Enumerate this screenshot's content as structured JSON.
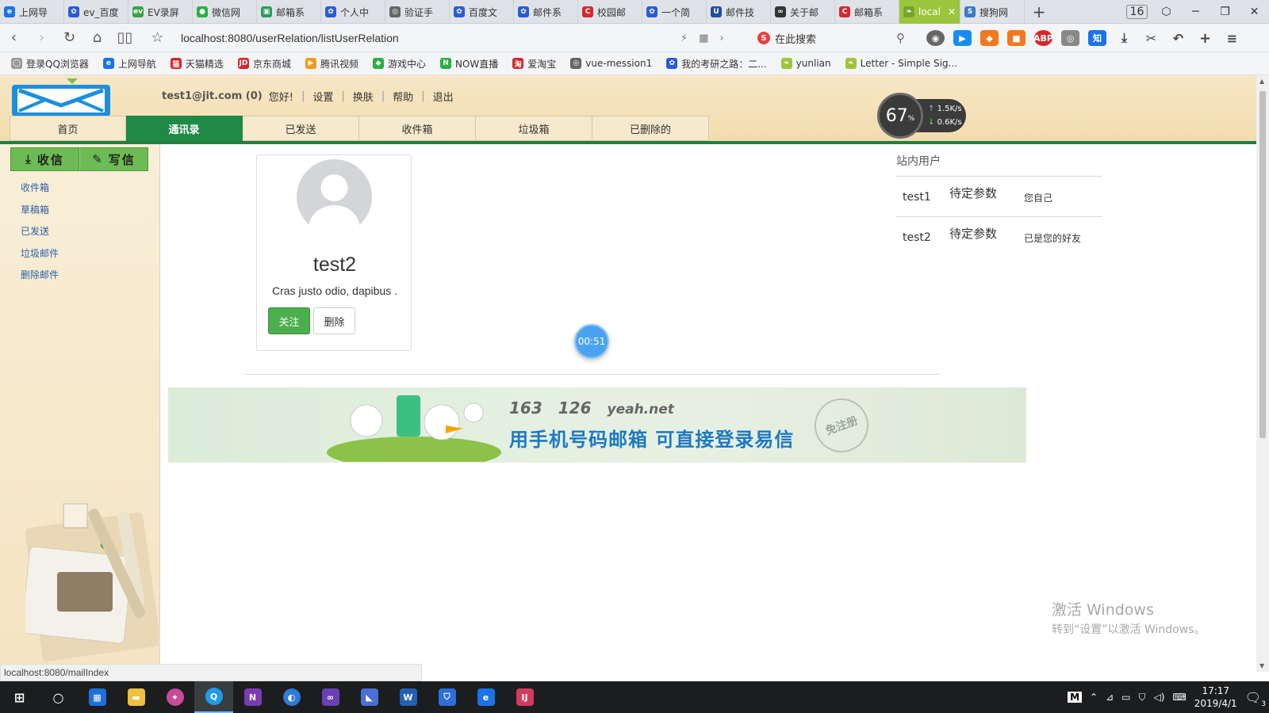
{
  "browser": {
    "tabs": [
      {
        "label": "上网导",
        "color": "#1a73e8",
        "glyph": "e"
      },
      {
        "label": "ev_百度",
        "color": "#2a5bd7",
        "glyph": "✿"
      },
      {
        "label": "EV录屏",
        "color": "#3aa14a",
        "glyph": "ev"
      },
      {
        "label": "微信网",
        "color": "#2aae43",
        "glyph": "●"
      },
      {
        "label": "邮箱系",
        "color": "#2b9d5f",
        "glyph": "▣"
      },
      {
        "label": "个人中",
        "color": "#2a5bd7",
        "glyph": "✿"
      },
      {
        "label": "验证手",
        "color": "#666666",
        "glyph": "◎"
      },
      {
        "label": "百度文",
        "color": "#2a5bd7",
        "glyph": "✿"
      },
      {
        "label": "邮件系",
        "color": "#2a5bd7",
        "glyph": "✿"
      },
      {
        "label": "校园邮",
        "color": "#d8262d",
        "glyph": "C"
      },
      {
        "label": "一个简",
        "color": "#2a5bd7",
        "glyph": "✿"
      },
      {
        "label": "邮件技",
        "color": "#1d4ea0",
        "glyph": "U"
      },
      {
        "label": "关于邮",
        "color": "#333333",
        "glyph": "∞"
      },
      {
        "label": "邮箱系",
        "color": "#d8262d",
        "glyph": "C"
      },
      {
        "label": "local",
        "color": "#7aa32d",
        "glyph": "❧",
        "active": true
      },
      {
        "label": "搜狗网",
        "color": "#3a79c6",
        "glyph": "S"
      }
    ],
    "tab_count": "16",
    "url": "localhost:8080/userRelation/listUserRelation",
    "search_placeholder": "在此搜索",
    "bookmarks": [
      {
        "label": "登录QQ浏览器",
        "color": "#999999",
        "glyph": "◯"
      },
      {
        "label": "上网导航",
        "color": "#1a73e8",
        "glyph": "e"
      },
      {
        "label": "天猫精选",
        "color": "#d8262d",
        "glyph": "猫"
      },
      {
        "label": "京东商城",
        "color": "#d8262d",
        "glyph": "JD"
      },
      {
        "label": "腾讯视频",
        "color": "#f29a1d",
        "glyph": "▶"
      },
      {
        "label": "游戏中心",
        "color": "#2aae43",
        "glyph": "◆"
      },
      {
        "label": "NOW直播",
        "color": "#2aae43",
        "glyph": "N"
      },
      {
        "label": "爱淘宝",
        "color": "#d8262d",
        "glyph": "淘"
      },
      {
        "label": "vue-mession1",
        "color": "#666666",
        "glyph": "◎"
      },
      {
        "label": "我的考研之路：二...",
        "color": "#2a5bd7",
        "glyph": "✿"
      },
      {
        "label": "yunlian",
        "color": "#9bc53d",
        "glyph": "❧"
      },
      {
        "label": "Letter - Simple Sig...",
        "color": "#9bc53d",
        "glyph": "❧"
      }
    ]
  },
  "header": {
    "user_email": "test1@jit.com (0)",
    "greeting": "您好!",
    "links": [
      "设置",
      "换肤",
      "帮助",
      "退出"
    ],
    "nav": [
      "首页",
      "通讯录",
      "已发送",
      "收件箱",
      "垃圾箱",
      "已删除的"
    ],
    "active_nav_index": 1
  },
  "speed_widget": {
    "percent": "67",
    "unit": "%",
    "up": "1.5K/s",
    "down": "0.6K/s"
  },
  "sidebar": {
    "receive_label": "收信",
    "compose_label": "写信",
    "folders": [
      "收件箱",
      "草稿箱",
      "已发送",
      "垃圾邮件",
      "删除邮件"
    ]
  },
  "contact_card": {
    "name": "test2",
    "description": "Cras justo odio, dapibus .",
    "follow_label": "关注",
    "delete_label": "删除"
  },
  "timer": "00:51",
  "banner": {
    "brand_1": "163",
    "brand_2": "126",
    "brand_3": "yeah.net",
    "slogan": "用手机号码邮箱  可直接登录易信",
    "stamp": "免注册"
  },
  "users_panel": {
    "title": "站内用户",
    "rows": [
      {
        "name": "test1",
        "param": "待定参数",
        "relation": "您自己"
      },
      {
        "name": "test2",
        "param": "待定参数",
        "relation": "已是您的好友"
      }
    ]
  },
  "watermark": {
    "line1": "激活 Windows",
    "line2": "转到“设置”以激活 Windows。"
  },
  "status_url": "localhost:8080/mailIndex",
  "taskbar": {
    "time": "17:17",
    "date": "2019/4/1",
    "notifications": "3",
    "ime": "M"
  }
}
